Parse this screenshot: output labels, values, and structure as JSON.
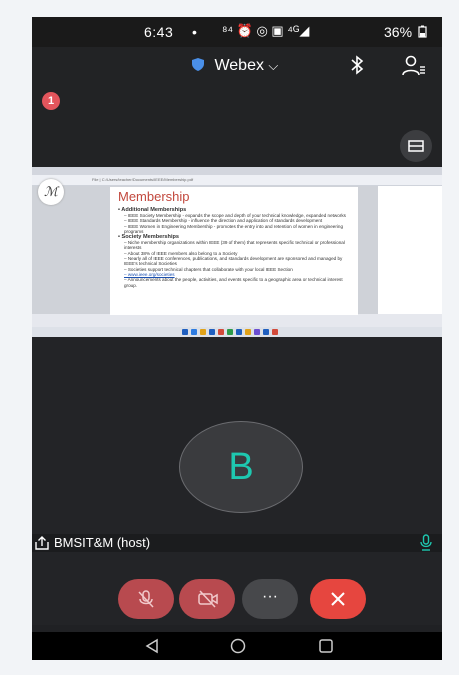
{
  "status_bar": {
    "time": "6:43",
    "dot": "•",
    "icons_text": "⁸⁴ ⏰ ◎ ▣ ⁴ᴳ◢",
    "battery": "36%"
  },
  "app": {
    "title": "Webex",
    "chevron": "⌵",
    "notification_count": "1",
    "bluetooth_icon": "bluetooth-icon",
    "participants_icon": "participants-icon"
  },
  "shared_screen": {
    "url": "File | C:/Users/teacher/Documents/IEEE/Membership.pdf",
    "pen_glyph": "ℳ",
    "slide": {
      "title": "Membership",
      "lines": [
        {
          "level": "h",
          "text": "Additional Memberships"
        },
        {
          "level": "l1",
          "text": "IEEE Society Membership - expands the scope and depth of your technical knowledge, expanded networks"
        },
        {
          "level": "l1",
          "text": "IEEE Standards Membership - influence the direction and application of standards development"
        },
        {
          "level": "l1",
          "text": "IEEE Women in Engineering Membership - promotes the entry into and retention of women in engineering programs"
        },
        {
          "level": "h",
          "text": "Society Memberships"
        },
        {
          "level": "l1",
          "text": "Niche membership organizations within IEEE (39 of them) that represents specific technical or professional interests"
        },
        {
          "level": "l1",
          "text": "About 38% of IEEE members also belong to a Society"
        },
        {
          "level": "l1",
          "text": "Nearly all of IEEE conferences, publications, and standards development are sponsored and managed by IEEE's technical Societies"
        },
        {
          "level": "l1",
          "text": "Societies support technical chapters that collaborate with your local IEEE Section"
        },
        {
          "level": "lnk",
          "text": "www.ieee.org/societies"
        },
        {
          "level": "l1",
          "text": "Announcements about the people, activities, and events specific to a geographic area or technical interest group."
        }
      ]
    }
  },
  "participant": {
    "initial": "B",
    "name": "BMSIT&M (host)"
  },
  "controls": {
    "more_label": "···"
  },
  "colors": {
    "accent_teal": "#1ec8b0",
    "mute_red": "#b84a4f",
    "end_red": "#e6463f",
    "slide_title": "#c2483d"
  }
}
